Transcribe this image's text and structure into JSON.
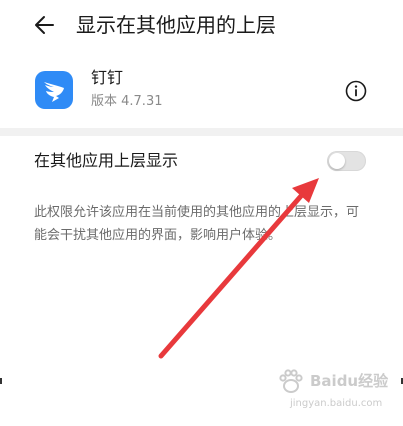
{
  "header": {
    "title": "显示在其他应用的上层",
    "back_icon": "arrow-left-icon"
  },
  "app": {
    "name": "钉钉",
    "version": "版本 4.7.31",
    "icon": "dingtalk-icon",
    "icon_color": "#2f8bf6",
    "info_icon": "info-icon"
  },
  "setting": {
    "label": "在其他应用上层显示",
    "toggle_state": "off",
    "description": "此权限允许该应用在当前使用的其他应用的上层显示，可能会干扰其他应用的界面，影响用户体验。"
  },
  "annotation": {
    "arrow_color": "#e8393c"
  },
  "watermark": {
    "text": "Baidu经验",
    "url": "jingyan.baidu.com"
  }
}
